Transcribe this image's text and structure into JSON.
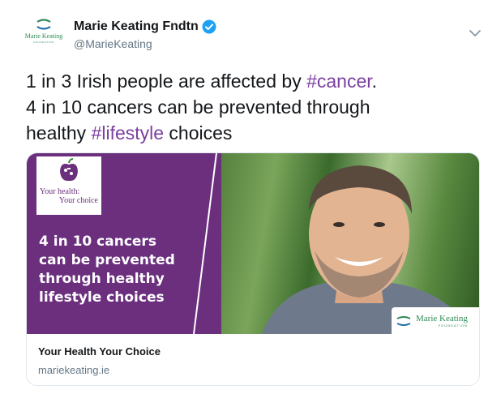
{
  "author": {
    "display_name": "Marie Keating Fndtn",
    "handle": "@MarieKeating",
    "avatar_logo_text": "Marie Keating",
    "avatar_logo_subtext": "FOUNDATION",
    "verified": true
  },
  "tweet": {
    "line1_prefix": "1 in 3 Irish people are affected by ",
    "line1_hashtag": "#cancer",
    "line1_suffix": ".",
    "line2": "4 in 10 cancers can be prevented through",
    "line3_prefix": "healthy ",
    "line3_hashtag": "#lifestyle",
    "line3_suffix": " choices"
  },
  "card": {
    "image": {
      "logo_tag_line1": "Your health:",
      "logo_tag_line2": "Your choice",
      "promo_text": "4 in 10 cancers\ncan be prevented\nthrough healthy\nlifestyle choices",
      "badge_line1": "Marie Keating",
      "badge_line2": "FOUNDATION"
    },
    "title": "Your Health Your Choice",
    "domain": "mariekeating.ie"
  },
  "colors": {
    "hashtag": "#7b3fa0",
    "promo_purple": "#6b2f7e",
    "foundation_green": "#2e8b57",
    "verified_blue": "#1da1f2"
  },
  "icons": [
    "marie-keating-logo-icon",
    "verified-badge-icon",
    "chevron-down-icon",
    "apple-icon"
  ]
}
